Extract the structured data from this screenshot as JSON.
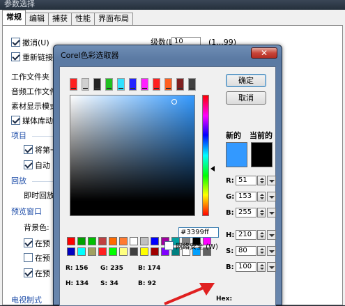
{
  "background_dialog": {
    "title": "参数选择",
    "tabs": [
      "常规",
      "编辑",
      "捕获",
      "性能",
      "界面布局"
    ],
    "undo_label": "撤消(U)",
    "levels_label": "级数(L):",
    "levels_value": "10",
    "levels_range": "(1...99)",
    "relink_label": "重新链接",
    "work_folder_label": "工作文件夹",
    "audio_folder_label": "音频工作文件",
    "material_display_label": "素材显示模式",
    "media_lib_label": "媒体库动",
    "project_section": "项目",
    "project_item1": "将第一",
    "project_item2": "自动",
    "playback_section": "回放",
    "instant_playback_label": "即时回放",
    "preview_section": "预览窗口",
    "background_color_label": "背景色:",
    "preview_item1": "在预",
    "preview_item2": "在预",
    "preview_item3": "在预",
    "tv_format_section": "电视制式"
  },
  "color_picker": {
    "title": "Corel色彩选取器",
    "close_glyph": "✕",
    "ok_label": "确定",
    "cancel_label": "取消",
    "new_label": "新的",
    "current_label": "当前的",
    "new_color": "#3399ff",
    "current_color": "#000000",
    "rgb": [
      {
        "label": "R:",
        "value": "51"
      },
      {
        "label": "G:",
        "value": "153"
      },
      {
        "label": "B:",
        "value": "255"
      }
    ],
    "hsb": [
      {
        "label": "H:",
        "value": "210"
      },
      {
        "label": "S:",
        "value": "80"
      },
      {
        "label": "B:",
        "value": "100"
      }
    ],
    "hover_info": {
      "r": "R: 156",
      "g": "G: 235",
      "b": "B: 174",
      "h": "H: 134",
      "s": "S: 34",
      "bv": "B: 92"
    },
    "hex_label": "Hex:",
    "hex_value": "#3399ff",
    "web_safe_label": "网络安全 (W)",
    "tool_icon_colors": [
      "#ff2020",
      "#d0d0d0",
      "#222222",
      "#20c020",
      "#30e0ff",
      "#2020ff",
      "#ff20ff",
      "#ff2020",
      "#ff6020",
      "#802020",
      "#404040"
    ],
    "palette_colors": [
      "#ff0000",
      "#00a000",
      "#00c000",
      "#c04040",
      "#ff6a00",
      "#ff7a30",
      "#ffffff",
      "#c0c0c0",
      "#0000ff",
      "#a000a0",
      "#00a0a0",
      "#808080",
      "#000000",
      "#ff00ff",
      "#0000c0",
      "#00ffff",
      "#a0a060",
      "#ff2020",
      "#00ff00",
      "#ffff80",
      "#404040",
      "#ffff00",
      "#a00000",
      "#8000ff",
      "#008080",
      "#ffffff",
      "#00a0ff",
      "#606060"
    ]
  }
}
